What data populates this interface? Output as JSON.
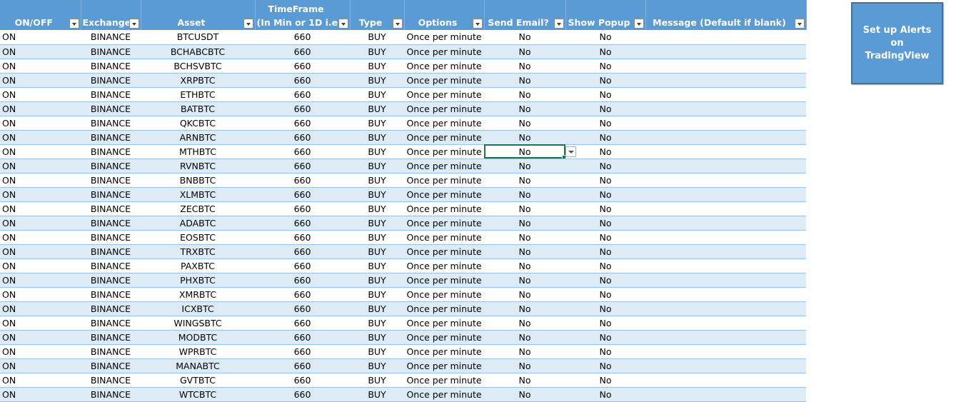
{
  "headers": [
    {
      "label": "ON/OFF"
    },
    {
      "label": "Exchange2"
    },
    {
      "label": "Asset"
    },
    {
      "label": "TimeFrame (In Min or 1D i.e)",
      "line1": "TimeFrame",
      "line2": "(In Min or 1D i.e)"
    },
    {
      "label": "Type"
    },
    {
      "label": "Options"
    },
    {
      "label": "Send Email?"
    },
    {
      "label": "Show Popup"
    },
    {
      "label": "Message (Default if blank)"
    }
  ],
  "rows": [
    [
      "ON",
      "BINANCE",
      "BTCUSDT",
      "660",
      "BUY",
      "Once per minute",
      "No",
      "No",
      ""
    ],
    [
      "ON",
      "BINANCE",
      "BCHABCBTC",
      "660",
      "BUY",
      "Once per minute",
      "No",
      "No",
      ""
    ],
    [
      "ON",
      "BINANCE",
      "BCHSVBTC",
      "660",
      "BUY",
      "Once per minute",
      "No",
      "No",
      ""
    ],
    [
      "ON",
      "BINANCE",
      "XRPBTC",
      "660",
      "BUY",
      "Once per minute",
      "No",
      "No",
      ""
    ],
    [
      "ON",
      "BINANCE",
      "ETHBTC",
      "660",
      "BUY",
      "Once per minute",
      "No",
      "No",
      ""
    ],
    [
      "ON",
      "BINANCE",
      "BATBTC",
      "660",
      "BUY",
      "Once per minute",
      "No",
      "No",
      ""
    ],
    [
      "ON",
      "BINANCE",
      "QKCBTC",
      "660",
      "BUY",
      "Once per minute",
      "No",
      "No",
      ""
    ],
    [
      "ON",
      "BINANCE",
      "ARNBTC",
      "660",
      "BUY",
      "Once per minute",
      "No",
      "No",
      ""
    ],
    [
      "ON",
      "BINANCE",
      "MTHBTC",
      "660",
      "BUY",
      "Once per minute",
      "No",
      "No",
      ""
    ],
    [
      "ON",
      "BINANCE",
      "RVNBTC",
      "660",
      "BUY",
      "Once per minute",
      "No",
      "No",
      ""
    ],
    [
      "ON",
      "BINANCE",
      "BNBBTC",
      "660",
      "BUY",
      "Once per minute",
      "No",
      "No",
      ""
    ],
    [
      "ON",
      "BINANCE",
      "XLMBTC",
      "660",
      "BUY",
      "Once per minute",
      "No",
      "No",
      ""
    ],
    [
      "ON",
      "BINANCE",
      "ZECBTC",
      "660",
      "BUY",
      "Once per minute",
      "No",
      "No",
      ""
    ],
    [
      "ON",
      "BINANCE",
      "ADABTC",
      "660",
      "BUY",
      "Once per minute",
      "No",
      "No",
      ""
    ],
    [
      "ON",
      "BINANCE",
      "EOSBTC",
      "660",
      "BUY",
      "Once per minute",
      "No",
      "No",
      ""
    ],
    [
      "ON",
      "BINANCE",
      "TRXBTC",
      "660",
      "BUY",
      "Once per minute",
      "No",
      "No",
      ""
    ],
    [
      "ON",
      "BINANCE",
      "PAXBTC",
      "660",
      "BUY",
      "Once per minute",
      "No",
      "No",
      ""
    ],
    [
      "ON",
      "BINANCE",
      "PHXBTC",
      "660",
      "BUY",
      "Once per minute",
      "No",
      "No",
      ""
    ],
    [
      "ON",
      "BINANCE",
      "XMRBTC",
      "660",
      "BUY",
      "Once per minute",
      "No",
      "No",
      ""
    ],
    [
      "ON",
      "BINANCE",
      "ICXBTC",
      "660",
      "BUY",
      "Once per minute",
      "No",
      "No",
      ""
    ],
    [
      "ON",
      "BINANCE",
      "WINGSBTC",
      "660",
      "BUY",
      "Once per minute",
      "No",
      "No",
      ""
    ],
    [
      "ON",
      "BINANCE",
      "MODBTC",
      "660",
      "BUY",
      "Once per minute",
      "No",
      "No",
      ""
    ],
    [
      "ON",
      "BINANCE",
      "WPRBTC",
      "660",
      "BUY",
      "Once per minute",
      "No",
      "No",
      ""
    ],
    [
      "ON",
      "BINANCE",
      "MANABTC",
      "660",
      "BUY",
      "Once per minute",
      "No",
      "No",
      ""
    ],
    [
      "ON",
      "BINANCE",
      "GVTBTC",
      "660",
      "BUY",
      "Once per minute",
      "No",
      "No",
      ""
    ],
    [
      "ON",
      "BINANCE",
      "WTCBTC",
      "660",
      "BUY",
      "Once per minute",
      "No",
      "No",
      ""
    ]
  ],
  "selected_cell": {
    "row": 8,
    "col": 6
  },
  "button": {
    "label": "Set up Alerts on TradingView"
  },
  "colors": {
    "header_bg": "#5b9bd5",
    "band": "#ddebf7",
    "button_bg": "#5b9bd5",
    "selection": "#217346"
  }
}
